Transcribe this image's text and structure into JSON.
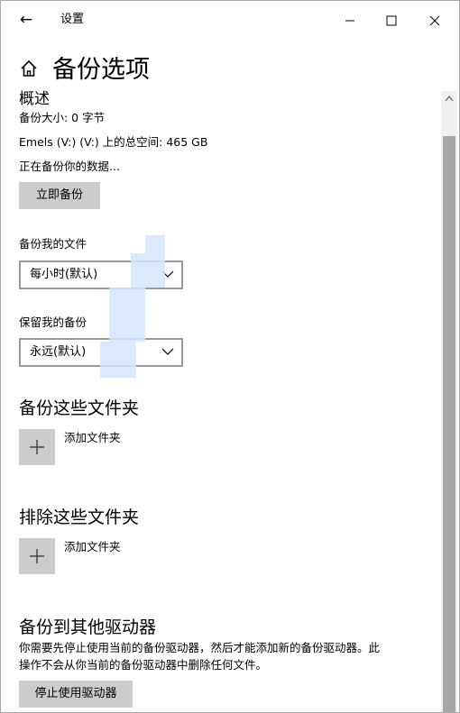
{
  "titlebar": {
    "back_glyph": "←",
    "title": "设置",
    "minimize_glyph": "—",
    "maximize_glyph": "☐",
    "close_glyph": "✕"
  },
  "header": {
    "title": "备份选项",
    "home_icon": "home-icon"
  },
  "overview": {
    "heading": "概述",
    "backup_size": "备份大小: 0 字节",
    "total_space": "Emels (V:) (V:) 上的总空间: 465 GB",
    "status": "正在备份你的数据...",
    "backup_now_label": "立即备份"
  },
  "backup_files": {
    "label": "备份我的文件",
    "selected": "每小时(默认)"
  },
  "keep_backups": {
    "label": "保留我的备份",
    "selected": "永远(默认)"
  },
  "include_folders": {
    "heading": "备份这些文件夹",
    "add_label": "添加文件夹"
  },
  "exclude_folders": {
    "heading": "排除这些文件夹",
    "add_label": "添加文件夹"
  },
  "other_drive": {
    "heading": "备份到其他驱动器",
    "description_line1": "你需要先停止使用当前的备份驱动器，然后才能添加新的备份驱动器。此",
    "description_line2": "操作不会从你当前的备份驱动器中删除任何文件。",
    "stop_label": "停止使用驱动器"
  },
  "colors": {
    "button_gray": "#cccccc",
    "scroll_thumb": "#a6a6a6",
    "border": "#999999"
  }
}
